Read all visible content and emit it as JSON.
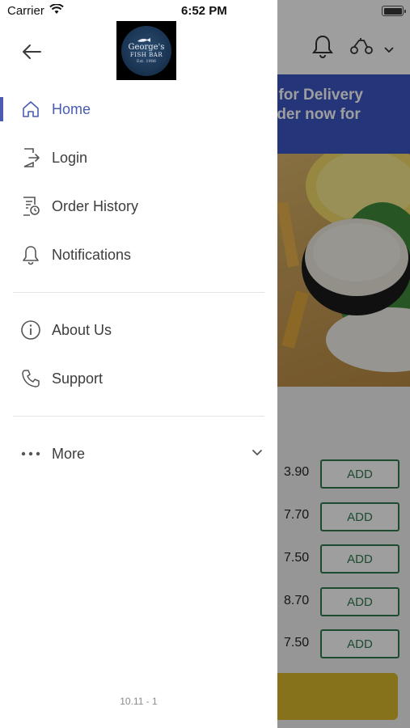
{
  "status_bar": {
    "carrier": "Carrier",
    "time": "6:52 PM"
  },
  "drawer": {
    "logo": {
      "name": "George's",
      "subtitle": "FISH BAR",
      "est": "Est. 1986"
    },
    "menu": [
      {
        "label": "Home",
        "icon": "home-icon",
        "active": true
      },
      {
        "label": "Login",
        "icon": "login-icon",
        "active": false
      },
      {
        "label": "Order History",
        "icon": "order-history-icon",
        "active": false
      },
      {
        "label": "Notifications",
        "icon": "bell-icon",
        "active": false
      }
    ],
    "menu2": [
      {
        "label": "About Us",
        "icon": "info-icon"
      },
      {
        "label": "Support",
        "icon": "phone-icon"
      }
    ],
    "more": {
      "label": "More"
    },
    "version": "10.11 - 1"
  },
  "background": {
    "banner_line1": "ed for Delivery",
    "banner_line2": "-order now for",
    "items": [
      {
        "price": "3.90",
        "button": "ADD"
      },
      {
        "price": "7.70",
        "button": "ADD"
      },
      {
        "price": "7.50",
        "button": "ADD"
      },
      {
        "price": "8.70",
        "button": "ADD"
      },
      {
        "price": "7.50",
        "button": "ADD"
      }
    ]
  },
  "colors": {
    "accent": "#4a5bb0",
    "banner": "#3b56c4",
    "add_green": "#2f7a4e",
    "checkout": "#d9b92a"
  }
}
